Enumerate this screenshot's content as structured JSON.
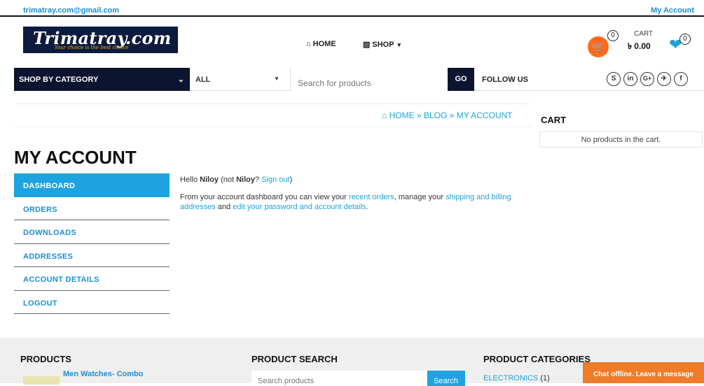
{
  "topbar": {
    "email": "trimatray.com@gmail.com",
    "my_account": "My Account"
  },
  "logo": {
    "title": "Trimatray.com",
    "tagline": "Your choice is the best choice"
  },
  "nav": {
    "home_icon": "home-icon",
    "home": "HOME",
    "shop_icon": "basket-icon",
    "shop": "SHOP",
    "shop_caret": "▾"
  },
  "cart": {
    "icon": "cart-icon",
    "count": "0",
    "label": "CART",
    "total": "৳ 0.00",
    "wishlist_icon": "heart-icon",
    "wishlist_count": "0"
  },
  "catbar": {
    "shop_by_category": "SHOP BY CATEGORY",
    "chevron": "⌄",
    "all": "ALL",
    "all_caret": "▼",
    "search_placeholder": "Search for products",
    "go": "GO",
    "follow_us": "FOLLOW US",
    "social": [
      {
        "icon": "skype-icon",
        "glyph": "S"
      },
      {
        "icon": "linkedin-icon",
        "glyph": "in"
      },
      {
        "icon": "google-plus-icon",
        "glyph": "G+"
      },
      {
        "icon": "twitter-icon",
        "glyph": "✈"
      },
      {
        "icon": "facebook-icon",
        "glyph": "f"
      }
    ]
  },
  "breadcrumb": {
    "home_icon": "home-icon",
    "home": "HOME",
    "sep1": "»",
    "blog": "BLOG",
    "sep2": "»",
    "current": "MY ACCOUNT"
  },
  "cart_widget": {
    "title": "CART",
    "empty": "No products in the cart."
  },
  "account": {
    "title": "MY ACCOUNT",
    "nav": [
      "DASHBOARD",
      "ORDERS",
      "DOWNLOADS",
      "ADDRESSES",
      "ACCOUNT DETAILS",
      "LOGOUT"
    ],
    "hello_prefix": "Hello ",
    "user": "Niloy",
    "not_prefix": " (not ",
    "not_user": "Niloy",
    "not_q": "? ",
    "sign_out": "Sign out",
    "close_paren": ")",
    "intro_1": "From your account dashboard you can view your ",
    "recent_orders": "recent orders",
    "intro_2": ", manage your ",
    "shipping": "shipping and billing addresses",
    "intro_3": " and ",
    "edit": "edit your password and account details",
    "intro_4": "."
  },
  "footer": {
    "products_title": "PRODUCTS",
    "product_name": "Men Watches- Combo",
    "search_title": "PRODUCT SEARCH",
    "search_placeholder": "Search products",
    "search_button": "Search",
    "categories_title": "PRODUCT CATEGORIES",
    "category": "ELECTRONICS",
    "category_count": " (1)",
    "chat": "Chat offline. Leave a message"
  }
}
